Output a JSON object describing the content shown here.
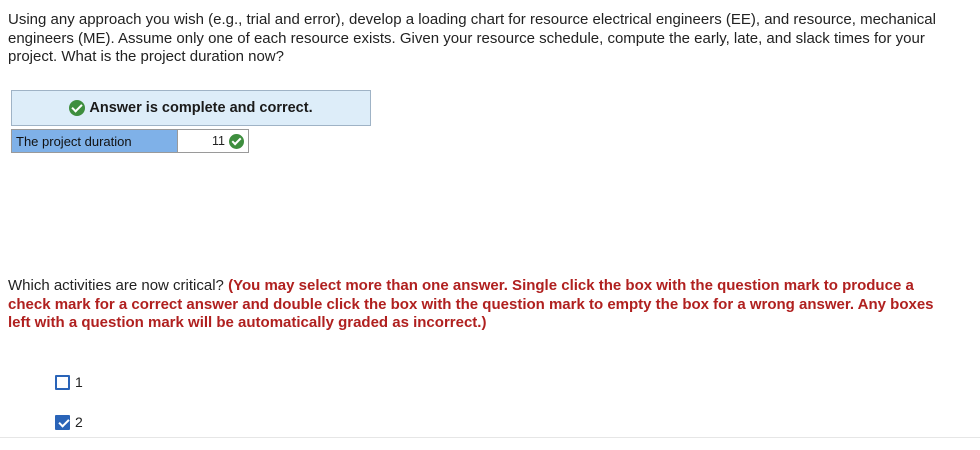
{
  "question1": {
    "text": "Using any approach you wish (e.g., trial and error), develop a loading chart for resource electrical engineers (EE), and resource, mechanical engineers (ME). Assume only one of each resource exists. Given your resource schedule, compute the early, late, and slack times for your project. What is the project duration now?"
  },
  "feedback": {
    "banner": "Answer is complete and correct."
  },
  "result": {
    "label": "The project duration",
    "value": "11"
  },
  "question2": {
    "text": "Which activities are now critical?",
    "instructions": "(You may select more than one answer. Single click the box with the question mark to produce a check mark for a correct answer and double click the box with the question mark to empty the box for a wrong answer. Any boxes left with a question mark will be automatically graded as incorrect.)",
    "options": [
      {
        "label": "1",
        "checked": false
      },
      {
        "label": "2",
        "checked": true
      }
    ]
  },
  "colors": {
    "banner_bg": "#ddedf9",
    "label_bg": "#7fb1e8",
    "correct_green": "#3e8e3e",
    "instruction_red": "#b0201f",
    "checkbox_blue": "#2a64b8"
  },
  "icons": {
    "correct": "check-circle-icon",
    "checkbox_checked": "checkbox-checked-icon",
    "checkbox_empty": "checkbox-empty-icon"
  }
}
